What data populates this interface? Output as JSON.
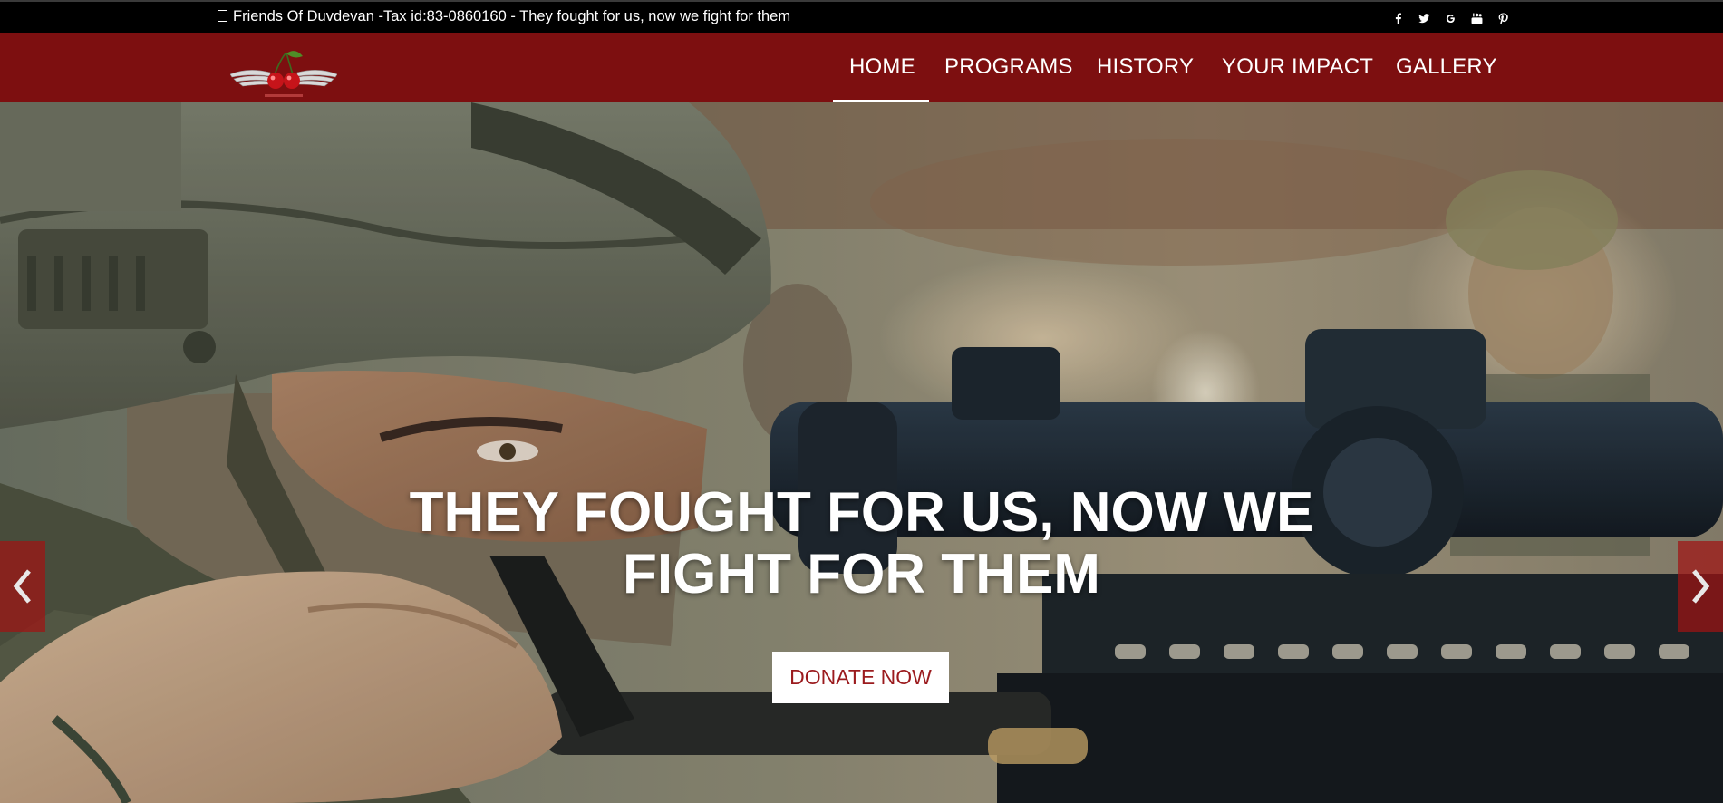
{
  "topbar": {
    "tagline": "Friends Of Duvdevan -Tax id:83-0860160 - They fought for us, now we fight for them",
    "social": [
      {
        "icon": "facebook-icon",
        "label": "f"
      },
      {
        "icon": "twitter-icon",
        "label": ""
      },
      {
        "icon": "google-plus-icon",
        "label": "g"
      },
      {
        "icon": "youtube-icon",
        "label": ""
      },
      {
        "icon": "pinterest-icon",
        "label": "p"
      }
    ]
  },
  "nav": {
    "items": [
      "HOME",
      "PROGRAMS",
      "HISTORY",
      "YOUR IMPACT",
      "GALLERY"
    ],
    "active": "HOME"
  },
  "hero": {
    "headline_line1": "THEY FOUGHT FOR US, NOW WE",
    "headline_line2": "FIGHT FOR THEM",
    "cta": "DONATE NOW"
  },
  "colors": {
    "brand": "#7d0f10",
    "topbar": "#000000",
    "cta_text": "#9b1b1e"
  }
}
